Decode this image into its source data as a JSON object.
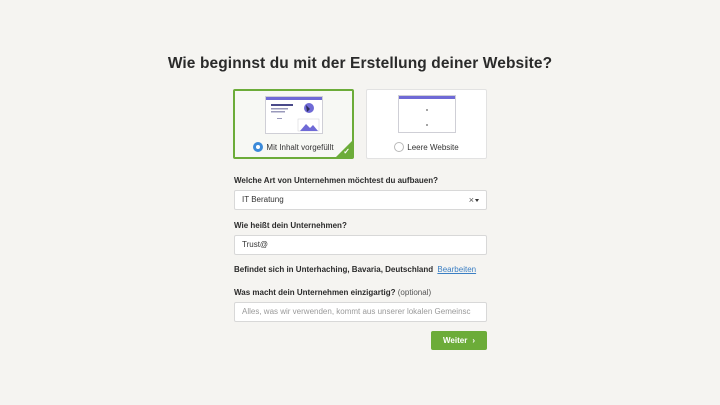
{
  "page": {
    "title": "Wie beginnst du mit der Erstellung deiner Website?"
  },
  "options": [
    {
      "label": "Mit Inhalt vorgefüllt",
      "selected": true
    },
    {
      "label": "Leere Website",
      "selected": false
    }
  ],
  "business_type": {
    "label": "Welche Art von Unternehmen möchtest du aufbauen?",
    "value": "IT Beratung",
    "clear_glyph": "×"
  },
  "business_name": {
    "label": "Wie heißt dein Unternehmen?",
    "value": "Trust@"
  },
  "location": {
    "text": "Befindet sich in Unterhaching, Bavaria, Deutschland",
    "edit_label": "Bearbeiten"
  },
  "uniqueness": {
    "label": "Was macht dein Unternehmen einzigartig?",
    "optional_label": "(optional)",
    "placeholder": "Alles, was wir verwenden, kommt aus unserer lokalen Gemeinsc"
  },
  "next_button": {
    "label": "Weiter",
    "chevron": "›"
  },
  "colors": {
    "accent_green": "#6cac39",
    "radio_blue": "#3b8ad9",
    "link_blue": "#3b7fc4",
    "thumb_purple": "#6f6ad6",
    "background": "#f5f4f1"
  }
}
